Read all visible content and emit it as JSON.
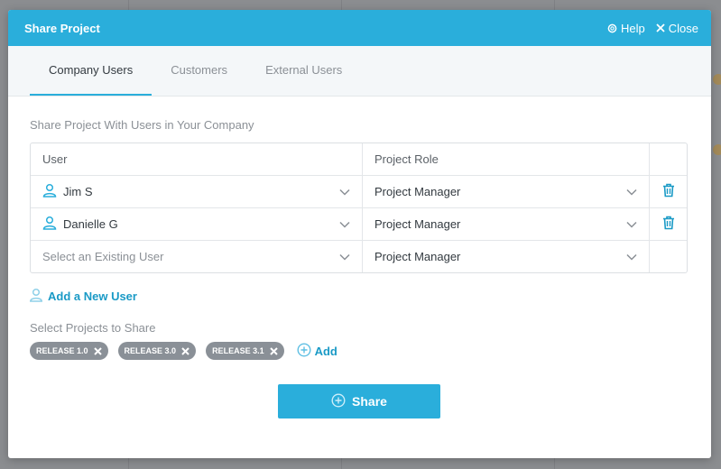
{
  "modal": {
    "title": "Share Project",
    "help_label": "Help",
    "close_label": "Close"
  },
  "tabs": [
    {
      "label": "Company Users",
      "active": true
    },
    {
      "label": "Customers",
      "active": false
    },
    {
      "label": "External Users",
      "active": false
    }
  ],
  "share_section": {
    "label": "Share Project With Users in Your Company",
    "columns": {
      "user": "User",
      "role": "Project Role"
    },
    "rows": [
      {
        "user": "Jim S",
        "role": "Project Manager",
        "deletable": true
      },
      {
        "user": "Danielle G",
        "role": "Project Manager",
        "deletable": true
      }
    ],
    "new_row": {
      "user_placeholder": "Select an Existing User",
      "role": "Project Manager"
    }
  },
  "add_user_label": "Add a New User",
  "projects": {
    "label": "Select Projects to Share",
    "chips": [
      "RELEASE 1.0",
      "RELEASE 3.0",
      "RELEASE 3.1"
    ],
    "add_label": "Add"
  },
  "share_button_label": "Share",
  "colors": {
    "accent": "#2aaedb",
    "link": "#1a9ac6",
    "chip": "#8a9097"
  }
}
